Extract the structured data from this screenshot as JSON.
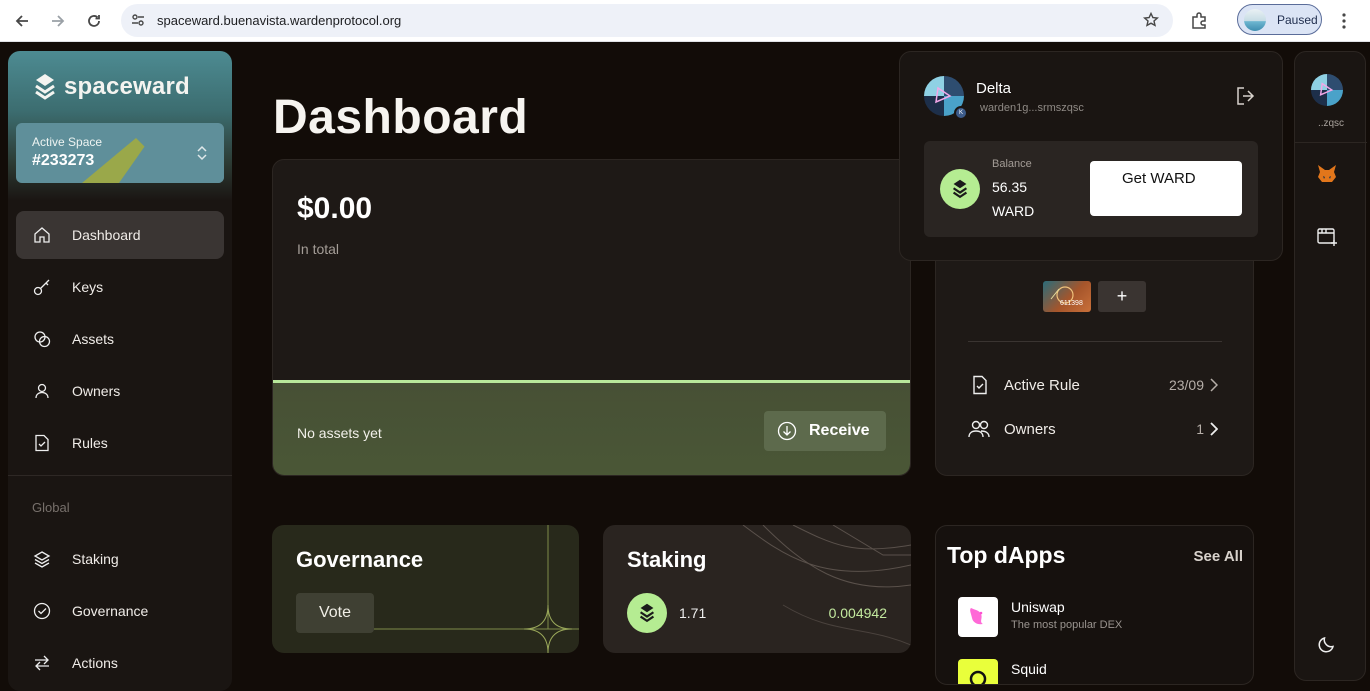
{
  "browser": {
    "url": "spaceward.buenavista.wardenprotocol.org",
    "profile_label": "Paused"
  },
  "sidebar": {
    "brand": "spaceward",
    "active_space_label": "Active Space",
    "active_space_id": "#233273",
    "items": [
      {
        "label": "Dashboard",
        "icon": "home-icon"
      },
      {
        "label": "Keys",
        "icon": "key-icon"
      },
      {
        "label": "Assets",
        "icon": "coins-icon"
      },
      {
        "label": "Owners",
        "icon": "user-icon"
      },
      {
        "label": "Rules",
        "icon": "document-icon"
      }
    ],
    "global_label": "Global",
    "global_items": [
      {
        "label": "Staking",
        "icon": "layers-icon"
      },
      {
        "label": "Governance",
        "icon": "check-circle-icon"
      },
      {
        "label": "Actions",
        "icon": "arrows-icon"
      }
    ]
  },
  "main": {
    "title": "Dashboard",
    "total": {
      "amount": "$0.00",
      "sub": "In total",
      "no_assets": "No assets yet",
      "receive_label": "Receive"
    },
    "governance": {
      "title": "Governance",
      "vote_label": "Vote"
    },
    "staking": {
      "title": "Staking",
      "value1": "1.71",
      "value2": "0.004942"
    },
    "space_detail": {
      "key_number": "611398",
      "add_label": "+",
      "active_rule_label": "Active Rule",
      "active_rule_value": "23/09",
      "owners_label": "Owners",
      "owners_value": "1"
    },
    "dapps": {
      "title": "Top dApps",
      "see_all": "See All",
      "items": [
        {
          "name": "Uniswap",
          "desc": "The most popular DEX"
        },
        {
          "name": "Squid",
          "desc": ""
        }
      ]
    }
  },
  "wallet": {
    "name": "Delta",
    "address": "warden1g...srmszqsc",
    "badge": "K",
    "balance_label": "Balance",
    "balance_value": "56.35 WARD",
    "get_ward_label": "Get WARD"
  },
  "rail": {
    "address_short": "..zqsc"
  },
  "colors": {
    "accent_green": "#b5ec92",
    "background": "#120c08",
    "card": "#1e1916"
  }
}
